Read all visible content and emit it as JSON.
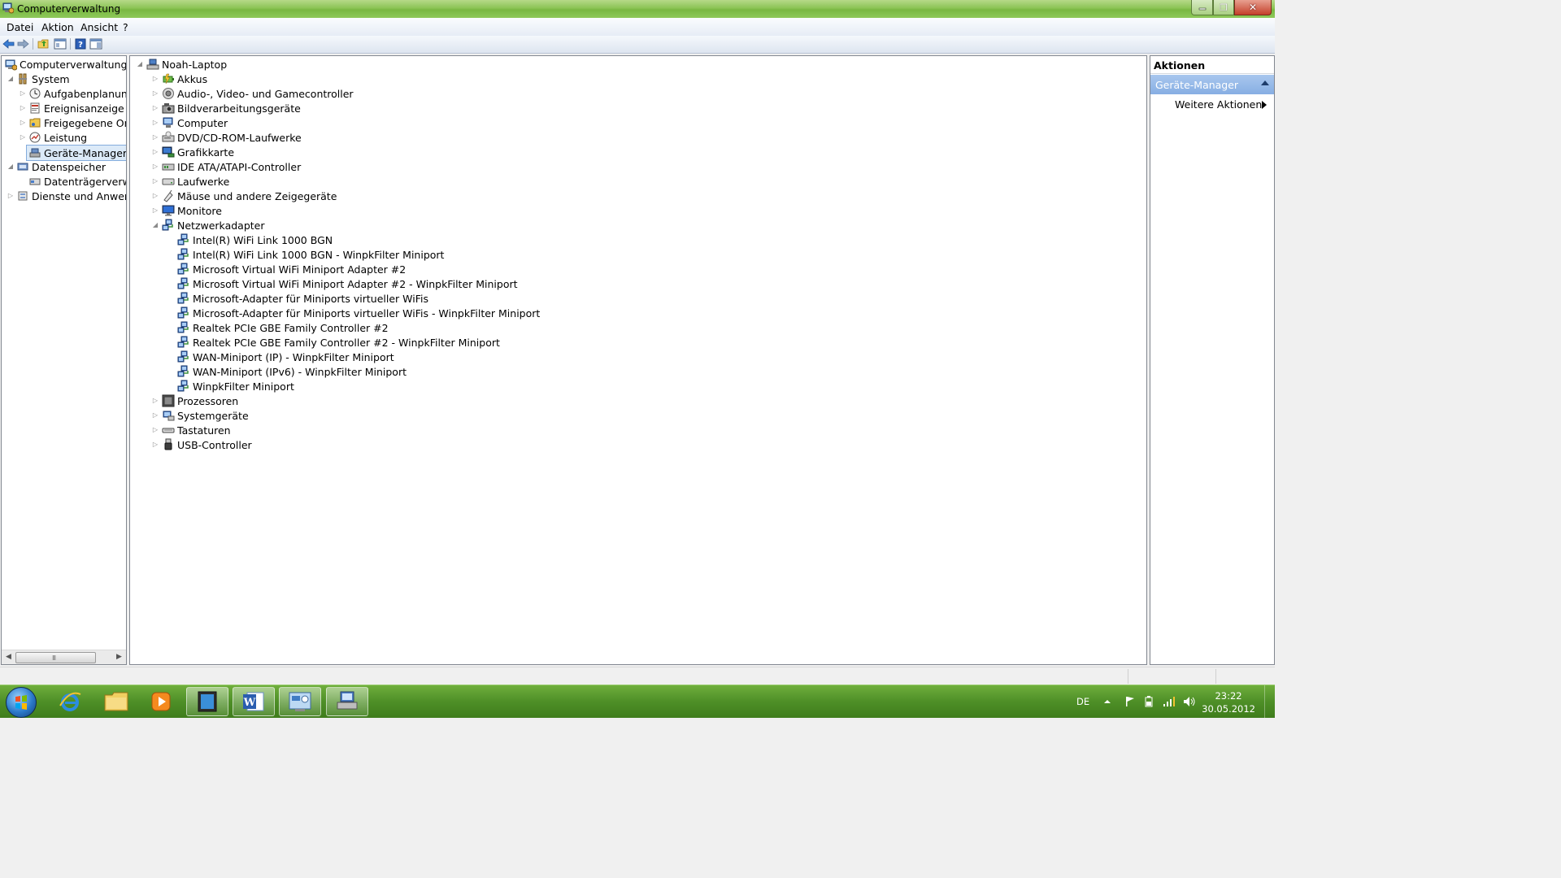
{
  "window": {
    "title": "Computerverwaltung",
    "close_glyph": "✕",
    "maximize_glyph": "❐"
  },
  "menu": {
    "file": "Datei",
    "action": "Aktion",
    "view": "Ansicht",
    "help": "?"
  },
  "left_tree": {
    "root": "Computerverwaltung (Lokal)",
    "system": "System",
    "task_scheduler": "Aufgabenplanung",
    "event_viewer": "Ereignisanzeige",
    "shared_folders": "Freigegebene Ordner",
    "performance": "Leistung",
    "device_manager": "Geräte-Manager",
    "storage": "Datenspeicher",
    "disk_mgmt": "Datenträgerverwaltung",
    "services": "Dienste und Anwendungen"
  },
  "device_tree": {
    "computer_name": "Noah-Laptop",
    "categories": [
      {
        "label": "Akkus",
        "icon": "battery-icon"
      },
      {
        "label": "Audio-, Video- und Gamecontroller",
        "icon": "speaker-icon"
      },
      {
        "label": "Bildverarbeitungsgeräte",
        "icon": "camera-icon"
      },
      {
        "label": "Computer",
        "icon": "computer-icon"
      },
      {
        "label": "DVD/CD-ROM-Laufwerke",
        "icon": "dvd-drive-icon"
      },
      {
        "label": "Grafikkarte",
        "icon": "display-adapter-icon"
      },
      {
        "label": "IDE ATA/ATAPI-Controller",
        "icon": "ide-controller-icon"
      },
      {
        "label": "Laufwerke",
        "icon": "disk-drive-icon"
      },
      {
        "label": "Mäuse und andere Zeigegeräte",
        "icon": "mouse-icon"
      },
      {
        "label": "Monitore",
        "icon": "monitor-icon"
      },
      {
        "label": "Netzwerkadapter",
        "icon": "network-adapter-icon"
      }
    ],
    "network_adapters": [
      "Intel(R) WiFi Link 1000 BGN",
      "Intel(R) WiFi Link 1000 BGN - WinpkFilter Miniport",
      "Microsoft Virtual WiFi Miniport Adapter #2",
      "Microsoft Virtual WiFi Miniport Adapter #2 - WinpkFilter Miniport",
      "Microsoft-Adapter für Miniports virtueller WiFis",
      "Microsoft-Adapter für Miniports virtueller WiFis - WinpkFilter Miniport",
      "Realtek PCIe GBE Family Controller #2",
      "Realtek PCIe GBE Family Controller #2 - WinpkFilter Miniport",
      "WAN-Miniport (IP) - WinpkFilter Miniport",
      "WAN-Miniport (IPv6) - WinpkFilter Miniport",
      "WinpkFilter Miniport"
    ],
    "categories_after": [
      {
        "label": "Prozessoren",
        "icon": "processor-icon"
      },
      {
        "label": "Systemgeräte",
        "icon": "system-device-icon"
      },
      {
        "label": "Tastaturen",
        "icon": "keyboard-icon"
      },
      {
        "label": "USB-Controller",
        "icon": "usb-icon"
      }
    ]
  },
  "actions": {
    "title": "Aktionen",
    "section": "Geräte-Manager",
    "more": "Weitere Aktionen"
  },
  "taskbar": {
    "language": "DE",
    "time": "23:22",
    "date": "30.05.2012"
  },
  "colors": {
    "selection_bg": "#dceaf8",
    "actions_header": "#97bbe9",
    "taskbar_green": "#4e8f27"
  }
}
